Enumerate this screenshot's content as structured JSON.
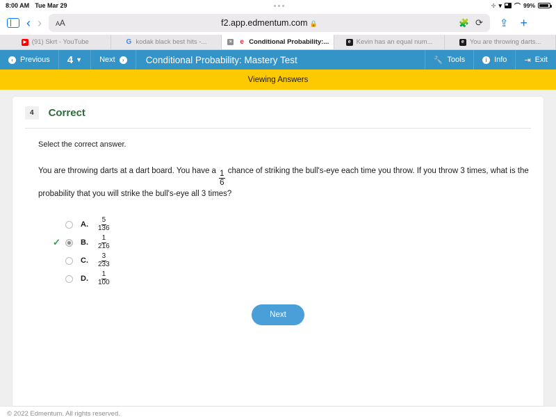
{
  "status_bar": {
    "time": "8:00 AM",
    "date": "Tue Mar 29",
    "battery_percent": "99%",
    "icons": [
      "location-icon",
      "wifi-icon",
      "screen-mirror-icon",
      "headphones-icon",
      "battery-icon"
    ]
  },
  "browser": {
    "sidebar_icon": "sidebar-icon",
    "back_icon": "chevron-left-icon",
    "forward_icon": "chevron-right-icon",
    "text_size_label": "AA",
    "url": "f2.app.edmentum.com",
    "lock_icon": "lock-icon",
    "extensions_icon": "puzzle-piece-icon",
    "reload_icon": "reload-icon",
    "share_icon": "share-icon",
    "new_tab_icon": "plus-icon",
    "tab_overview_icon": "tab-grid-icon",
    "tabs": [
      {
        "title": "(91) Skrt - YouTube",
        "favicon": "youtube-icon",
        "active": false
      },
      {
        "title": "kodak black best hits -...",
        "favicon": "google-icon",
        "active": false
      },
      {
        "title": "Conditional Probability:...",
        "favicon": "edmentum-icon",
        "active": true,
        "close_label": "×"
      },
      {
        "title": "Kevin has an equal num...",
        "favicon": "edmentum-dark-icon",
        "active": false
      },
      {
        "title": "You are throwing darts...",
        "favicon": "edmentum-dark-icon",
        "active": false
      }
    ]
  },
  "nav": {
    "previous_label": "Previous",
    "previous_icon": "arrow-left-circle-icon",
    "page_number": "4",
    "page_caret_icon": "chevron-down-icon",
    "next_label": "Next",
    "next_icon": "arrow-right-circle-icon",
    "title": "Conditional Probability: Mastery Test",
    "tools_label": "Tools",
    "tools_icon": "wrench-icon",
    "info_label": "Info",
    "info_icon": "info-circle-icon",
    "exit_label": "Exit",
    "exit_icon": "exit-icon"
  },
  "banner": {
    "text": "Viewing Answers",
    "background": "#fdc900"
  },
  "question": {
    "number": "4",
    "status": "Correct",
    "status_color": "#2f6b3a",
    "instruction": "Select the correct answer.",
    "text_part1": "You are throwing darts at a dart board. You have a ",
    "probability": {
      "numerator": "1",
      "denominator": "6"
    },
    "text_part2": " chance of striking the bull's-eye each time you throw. If you throw 3 times, what is the probability that you will strike the bull's-eye all 3 times?",
    "options": [
      {
        "letter": "A.",
        "numerator": "5",
        "denominator": "136",
        "selected": false,
        "correct_mark": ""
      },
      {
        "letter": "B.",
        "numerator": "1",
        "denominator": "216",
        "selected": true,
        "correct_mark": "✓"
      },
      {
        "letter": "C.",
        "numerator": "3",
        "denominator": "233",
        "selected": false,
        "correct_mark": ""
      },
      {
        "letter": "D.",
        "numerator": "1",
        "denominator": "100",
        "selected": false,
        "correct_mark": ""
      }
    ],
    "next_button": "Next",
    "next_button_color": "#4b9fd8"
  },
  "footer": {
    "copyright": "© 2022 Edmentum. All rights reserved."
  }
}
